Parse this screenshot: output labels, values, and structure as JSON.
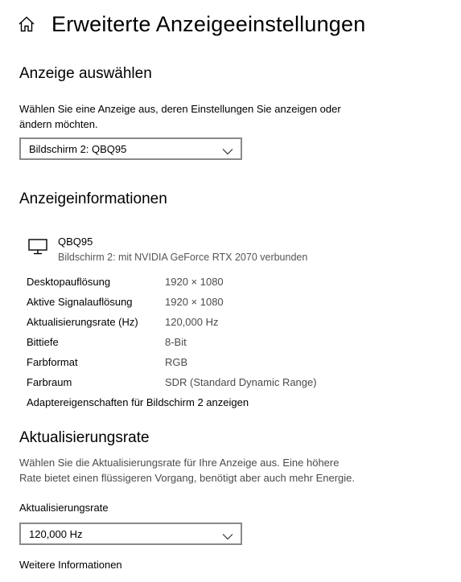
{
  "header": {
    "title": "Erweiterte Anzeigeeinstellungen",
    "icon": "home-icon"
  },
  "select_display": {
    "heading": "Anzeige auswählen",
    "description_line1": "Wählen Sie eine Anzeige aus, deren Einstellungen Sie anzeigen oder",
    "description_line2": "ändern möchten.",
    "selected": "Bildschirm 2: QBQ95"
  },
  "display_info": {
    "heading": "Anzeigeinformationen",
    "monitor_icon": "monitor-icon",
    "monitor_name": "QBQ95",
    "monitor_subtitle": "Bildschirm 2: mit NVIDIA GeForce RTX 2070 verbunden",
    "rows": [
      {
        "label": "Desktopauflösung",
        "value": "1920 × 1080"
      },
      {
        "label": "Aktive Signalauflösung",
        "value": "1920 × 1080"
      },
      {
        "label": "Aktualisierungsrate (Hz)",
        "value": "120,000 Hz"
      },
      {
        "label": "Bittiefe",
        "value": "8-Bit"
      },
      {
        "label": "Farbformat",
        "value": "RGB"
      },
      {
        "label": "Farbraum",
        "value": "SDR (Standard Dynamic Range)"
      }
    ],
    "adapter_link": "Adaptereigenschaften für Bildschirm 2 anzeigen"
  },
  "refresh_rate": {
    "heading": "Aktualisierungsrate",
    "description_line1": "Wählen Sie die Aktualisierungsrate für Ihre Anzeige aus. Eine höhere",
    "description_line2": "Rate bietet einen flüssigeren Vorgang, benötigt aber auch mehr Energie.",
    "field_label": "Aktualisierungsrate",
    "selected": "120,000 Hz",
    "more_info": "Weitere Informationen"
  }
}
